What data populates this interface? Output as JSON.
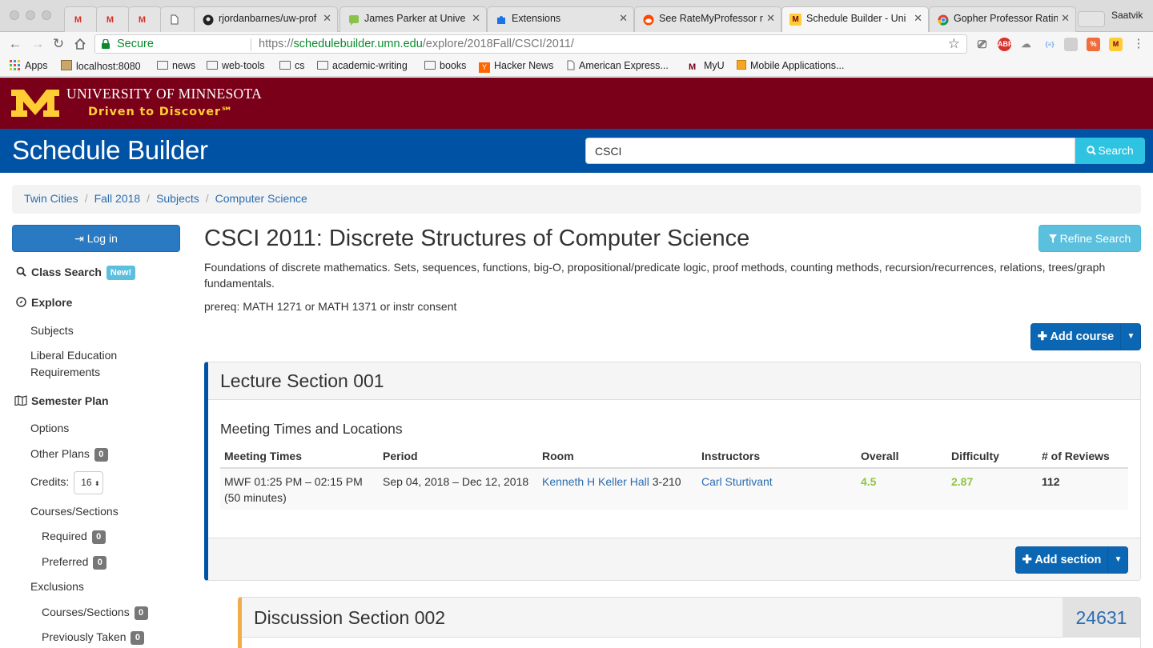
{
  "browser": {
    "profile": "Saatvik",
    "tabs": [
      {
        "title": "",
        "icon": "gmail-icon"
      },
      {
        "title": "",
        "icon": "gmail-icon"
      },
      {
        "title": "",
        "icon": "gmail-icon"
      },
      {
        "title": "",
        "icon": "page-icon"
      },
      {
        "title": "rjordanbarnes/uw-prof",
        "icon": "github-icon"
      },
      {
        "title": "James Parker at Unive",
        "icon": "chat-icon"
      },
      {
        "title": "Extensions",
        "icon": "puzzle-icon"
      },
      {
        "title": "See RateMyProfessor r",
        "icon": "reddit-icon"
      },
      {
        "title": "Schedule Builder - Uni",
        "icon": "umn-icon"
      },
      {
        "title": "Gopher Professor Ratin",
        "icon": "chrome-icon"
      }
    ],
    "omnibox": {
      "secure_label": "Secure",
      "url_scheme": "https://",
      "url_host": "schedulebuilder.umn.edu",
      "url_path": "/explore/2018Fall/CSCI/2011/"
    },
    "extensions": {
      "abp": "ABP",
      "json": "{≡}"
    },
    "bookmarks": [
      "Apps",
      "localhost:8080",
      "news",
      "web-tools",
      "cs",
      "academic-writing",
      "books",
      "Hacker News",
      "American Express...",
      "MyU",
      "Mobile Applications..."
    ]
  },
  "umn": {
    "name": "UNIVERSITY OF MINNESOTA",
    "tagline": "Driven to Discover℠",
    "colors": {
      "maroon": "#7a0019",
      "gold": "#ffcc33",
      "blue": "#0052a5"
    }
  },
  "app": {
    "title": "Schedule Builder",
    "search_value": "CSCI",
    "search_button": "Search"
  },
  "breadcrumb": [
    "Twin Cities",
    "Fall 2018",
    "Subjects",
    "Computer Science"
  ],
  "sidebar": {
    "login": "Log in",
    "class_search": "Class Search",
    "new_badge": "New!",
    "explore": "Explore",
    "subjects": "Subjects",
    "liberal_ed_line1": "Liberal Education",
    "liberal_ed_line2": "Requirements",
    "semester_plan": "Semester Plan",
    "options": "Options",
    "other_plans": "Other Plans",
    "other_plans_count": "0",
    "credits_label": "Credits:",
    "credits_value": "16",
    "courses_sections": "Courses/Sections",
    "required": "Required",
    "required_count": "0",
    "preferred": "Preferred",
    "preferred_count": "0",
    "exclusions": "Exclusions",
    "excl_courses": "Courses/Sections",
    "excl_courses_count": "0",
    "previously_taken": "Previously Taken",
    "previously_taken_count": "0"
  },
  "course": {
    "title": "CSCI 2011: Discrete Structures of Computer Science",
    "refine_button": "Refine Search",
    "description": "Foundations of discrete mathematics. Sets, sequences, functions, big-O, propositional/predicate logic, proof methods, counting methods, recursion/recurrences, relations, trees/graph fundamentals.",
    "prereq": "prereq: MATH 1271 or MATH 1371 or instr consent",
    "add_course": "Add course"
  },
  "lecture": {
    "title": "Lecture Section 001",
    "meeting_heading": "Meeting Times and Locations",
    "columns": [
      "Meeting Times",
      "Period",
      "Room",
      "Instructors",
      "Overall",
      "Difficulty",
      "# of Reviews"
    ],
    "row": {
      "time": "MWF 01:25 PM – 02:15 PM",
      "duration": "(50 minutes)",
      "period": "Sep 04, 2018 – Dec 12, 2018",
      "building": "Kenneth H Keller Hall",
      "room": "3-210",
      "instructor": "Carl Sturtivant",
      "overall": "4.5",
      "difficulty": "2.87",
      "reviews": "112"
    },
    "add_section": "Add section"
  },
  "discussion": {
    "title": "Discussion Section 002",
    "class_number": "24631"
  }
}
